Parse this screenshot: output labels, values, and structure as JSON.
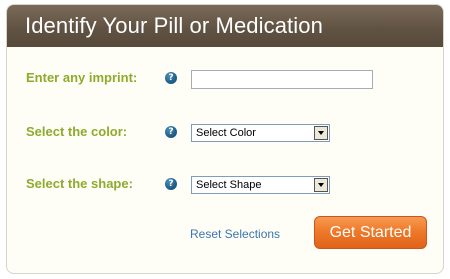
{
  "header": {
    "title": "Identify Your Pill or Medication"
  },
  "form": {
    "imprint": {
      "label": "Enter any imprint:",
      "help_icon": "help-icon",
      "value": "",
      "placeholder": ""
    },
    "color": {
      "label": "Select the color:",
      "help_icon": "help-icon",
      "selected": "Select Color"
    },
    "shape": {
      "label": "Select the shape:",
      "help_icon": "help-icon",
      "selected": "Select Shape"
    }
  },
  "actions": {
    "reset_label": "Reset Selections",
    "submit_label": "Get Started"
  },
  "colors": {
    "header_bg": "#615343",
    "label_green": "#8dab2f",
    "link_blue": "#3a76b0",
    "button_orange": "#ee7a2a",
    "help_icon_blue": "#1f5f88"
  }
}
